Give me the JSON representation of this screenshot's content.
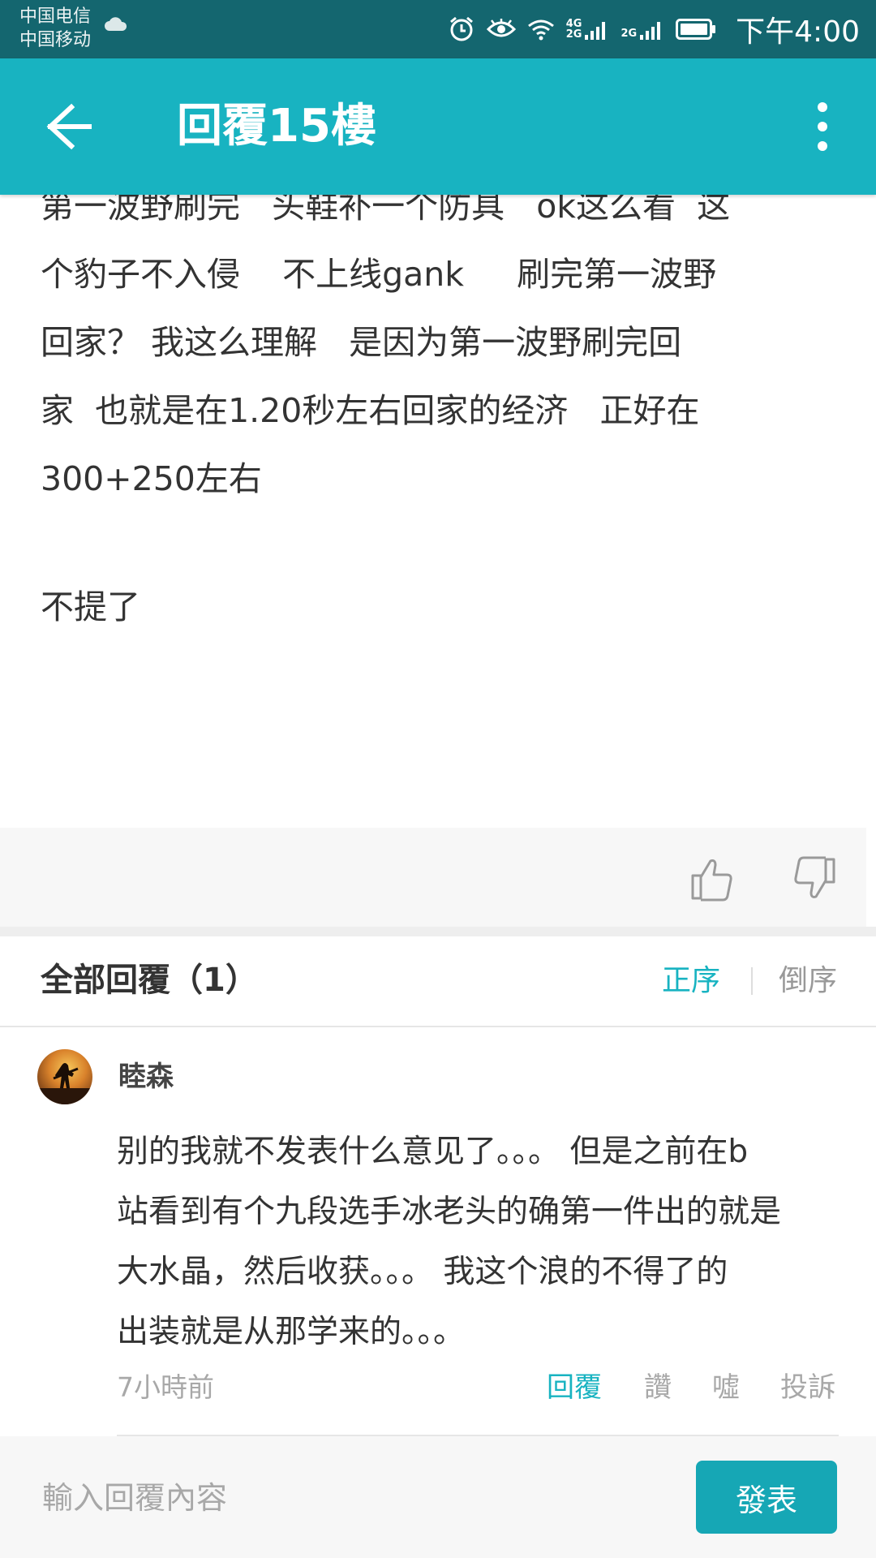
{
  "status_bar": {
    "carrier_1": "中国电信",
    "carrier_2": "中国移动",
    "time": "下午4:00",
    "network_1": "4G",
    "network_1b": "2G",
    "network_2": "2G",
    "icons": [
      "cloud-icon",
      "alarm-icon",
      "eye-icon",
      "wifi-icon",
      "signal-icon",
      "battery-icon"
    ]
  },
  "app_bar": {
    "title": "回覆15樓",
    "back_icon": "arrow-left-icon",
    "more_icon": "more-vertical-icon",
    "background": "#18b3c1"
  },
  "post": {
    "lines": [
      "第一波野刷完   头鞋补一个防具   ok这么看  这",
      "个豹子不入侵    不上线gank     刷完第一波野",
      "回家？ 我这么理解   是因为第一波野刷完回",
      "家  也就是在1.20秒左右回家的经济   正好在",
      "300+250左右",
      "",
      "不提了"
    ]
  },
  "votes": {
    "like_icon": "thumbs-up-icon",
    "dislike_icon": "thumbs-down-icon"
  },
  "replies": {
    "header": "全部回覆（1）",
    "sort_asc": "正序",
    "sort_desc": "倒序",
    "items": [
      {
        "user": "睦森",
        "lines": [
          "别的我就不发表什么意见了。。。 但是之前在b",
          "站看到有个九段选手冰老头的确第一件出的就是",
          "大水晶，然后收获。。。 我这个浪的不得了的",
          "出装就是从那学来的。。。"
        ],
        "time": "7小時前",
        "actions": {
          "reply": "回覆",
          "like": "讚",
          "boo": "噓",
          "report": "投訴"
        }
      }
    ]
  },
  "compose": {
    "placeholder": "輸入回覆內容",
    "value": "",
    "submit": "發表"
  },
  "colors": {
    "accent": "#18b3c1",
    "status_bar": "#14666f",
    "muted_text": "#a8a8a8"
  }
}
